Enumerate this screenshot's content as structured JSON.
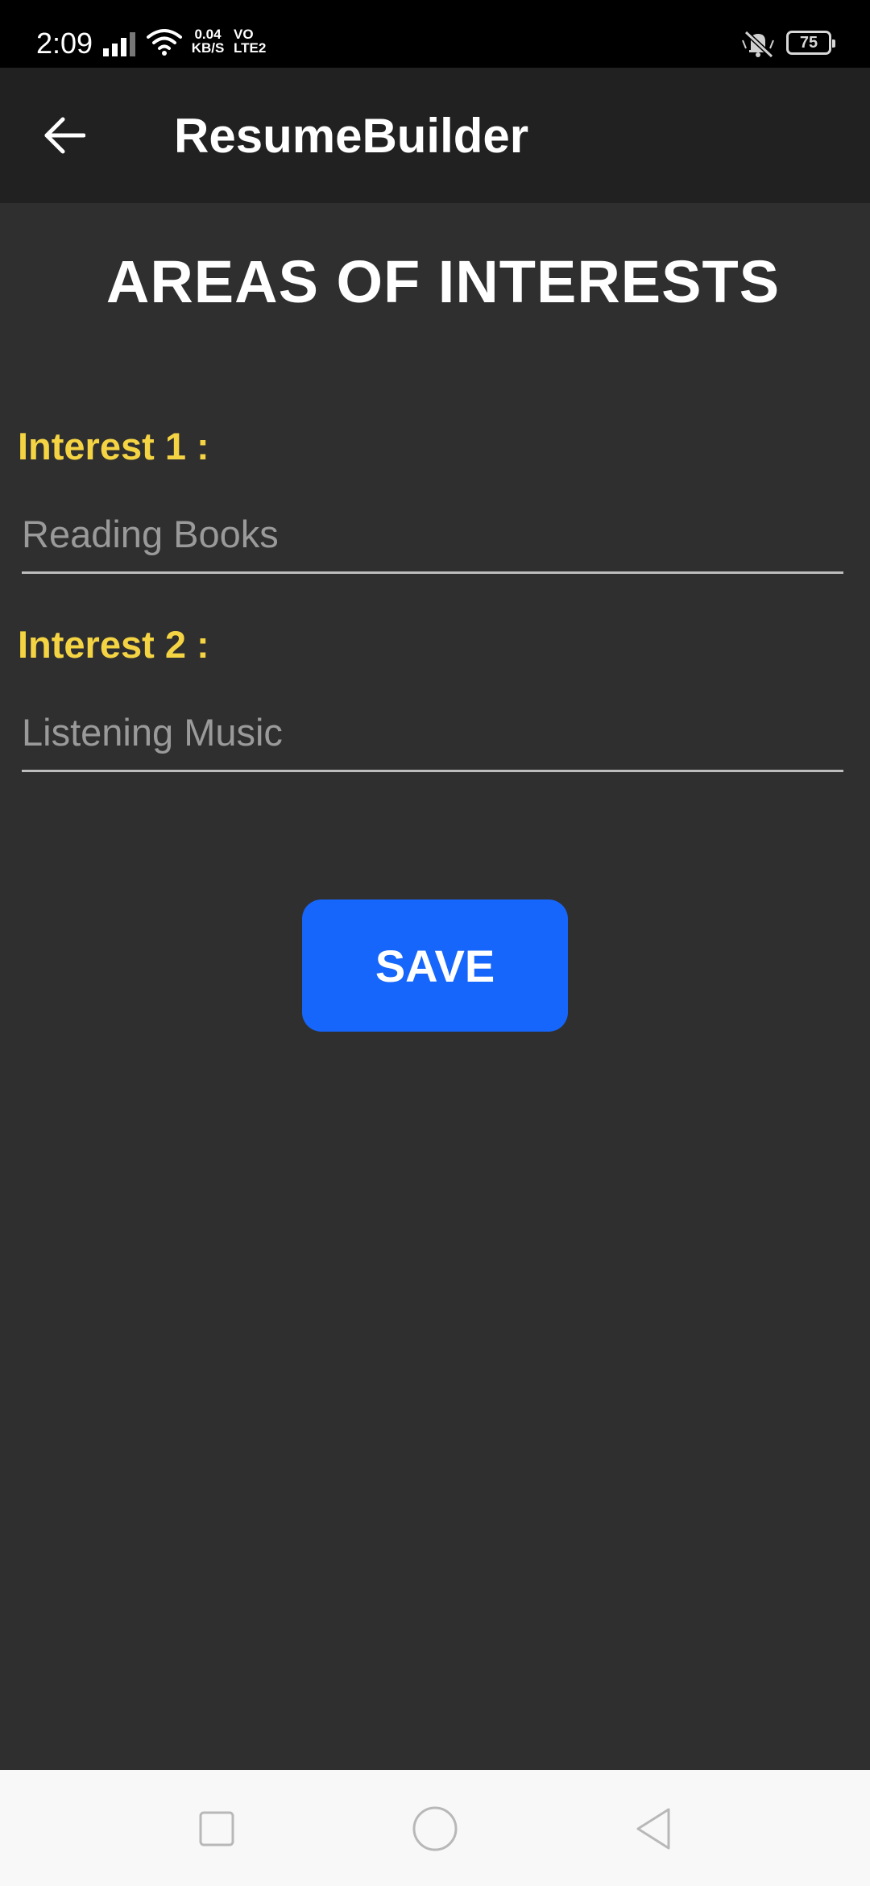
{
  "status_bar": {
    "time": "2:09",
    "speed_value": "0.04",
    "speed_unit": "KB/S",
    "network_top": "VO",
    "network_bottom": "LTE2",
    "battery_level": "75"
  },
  "app_bar": {
    "title": "ResumeBuilder",
    "back_icon": "arrow-left-icon"
  },
  "page": {
    "heading": "AREAS OF INTERESTS",
    "fields": [
      {
        "label": "Interest 1 :",
        "value": "",
        "placeholder": "Reading Books"
      },
      {
        "label": "Interest 2 :",
        "value": "",
        "placeholder": "Listening Music"
      }
    ],
    "save_label": "SAVE"
  },
  "nav_bar": {
    "recents_icon": "square-icon",
    "home_icon": "circle-icon",
    "back_icon": "triangle-back-icon"
  },
  "colors": {
    "background": "#2f2f2f",
    "app_bar": "#212121",
    "label": "#f5d443",
    "button": "#1766fb"
  }
}
